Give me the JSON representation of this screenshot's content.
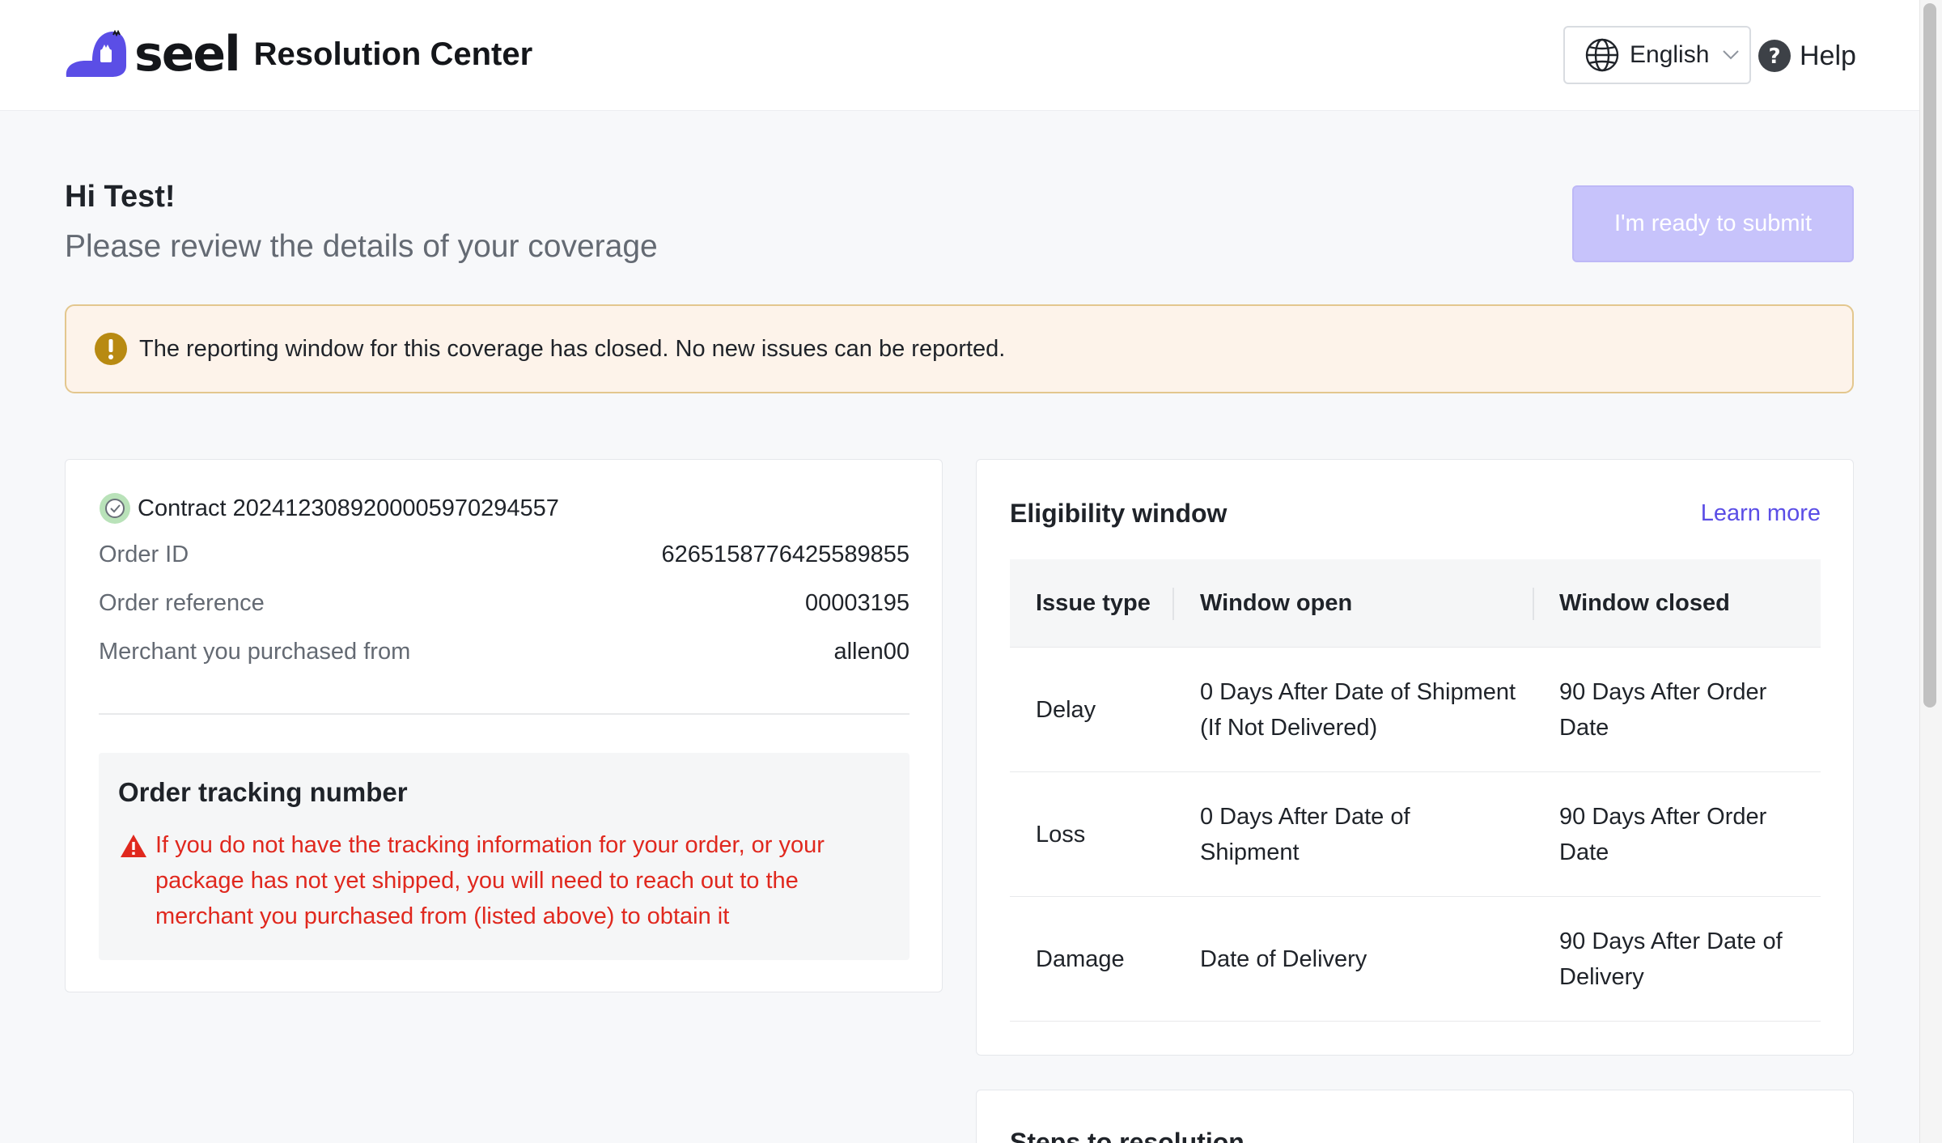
{
  "header": {
    "brand_word": "seel",
    "title": "Resolution Center",
    "language": "English",
    "help_label": "Help"
  },
  "greeting": {
    "title": "Hi Test!",
    "subtitle": "Please review the details of your coverage"
  },
  "submit_button": {
    "label": "I'm ready to submit",
    "disabled": true
  },
  "alert": {
    "text": "The reporting window for this coverage has closed. No new issues can be reported."
  },
  "contract": {
    "label": "Contract 20241230892000059702945​57",
    "rows": [
      {
        "label": "Order ID",
        "value": "6265158776425589855"
      },
      {
        "label": "Order reference",
        "value": "00003195"
      },
      {
        "label": "Merchant you purchased from",
        "value": "allen00"
      }
    ]
  },
  "tracking": {
    "title": "Order tracking number",
    "warning": "If you do not have the tracking information for your order, or your package has not yet shipped, you will need to reach out to the merchant you purchased from (listed above) to obtain it"
  },
  "eligibility": {
    "title": "Eligibility window",
    "learn_more": "Learn more",
    "columns": [
      "Issue type",
      "Window open",
      "Window closed"
    ],
    "rows": [
      {
        "issue": "Delay",
        "open": "0 Days After Date of Shipment (If Not Delivered)",
        "closed": "90 Days After Order Date"
      },
      {
        "issue": "Loss",
        "open": "0 Days After Date of Shipment",
        "closed": "90 Days After Order Date"
      },
      {
        "issue": "Damage",
        "open": "Date of Delivery",
        "closed": "90 Days After Date of Delivery"
      }
    ]
  },
  "steps": {
    "title": "Steps to resolution"
  },
  "colors": {
    "brand": "#5b4ee6",
    "submit_disabled": "#c7c3fb",
    "alert_bg": "#fdf3ea",
    "alert_icon": "#b88a12",
    "error": "#e0281e",
    "verified": "#9cd49c"
  }
}
